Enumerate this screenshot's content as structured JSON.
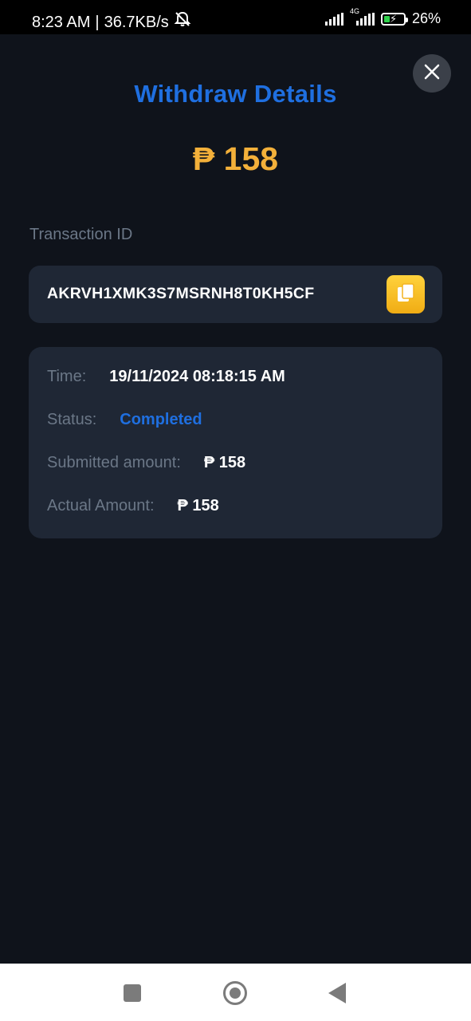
{
  "status_bar": {
    "time": "8:23 AM",
    "separator": "|",
    "speed": "36.7KB/s",
    "network_type": "4G",
    "battery": "26%",
    "icons": [
      "mute-bell-icon",
      "signal-icon",
      "4g-signal-icon",
      "battery-charging-icon"
    ]
  },
  "header": {
    "title": "Withdraw Details",
    "amount": "₱ 158"
  },
  "transaction": {
    "label": "Transaction ID",
    "id": "AKRVH1XMK3S7MSRNH8T0KH5CF"
  },
  "details": {
    "time_label": "Time:",
    "time_value": "19/11/2024 08:18:15 AM",
    "status_label": "Status:",
    "status_value": "Completed",
    "submitted_label": "Submitted amount:",
    "submitted_value": "₱ 158",
    "actual_label": "Actual Amount:",
    "actual_value": "₱ 158"
  },
  "colors": {
    "background": "#0f131b",
    "card": "#1f2735",
    "title_blue": "#1f6fe0",
    "amount_gold": "#f3b03a",
    "copy_button": "#f6bf2a"
  }
}
